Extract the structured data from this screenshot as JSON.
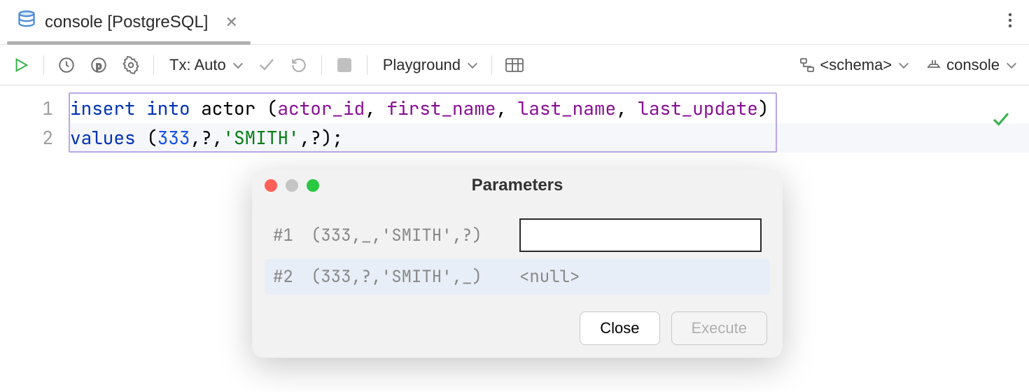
{
  "tab": {
    "label": "console [PostgreSQL]"
  },
  "toolbar": {
    "tx_label": "Tx: Auto",
    "playground_label": "Playground",
    "schema_label": "<schema>",
    "console_label": "console"
  },
  "editor": {
    "lines": [
      {
        "num": "1",
        "segments": [
          {
            "text": "insert into",
            "cls": "kw"
          },
          {
            "text": " actor (",
            "cls": ""
          },
          {
            "text": "actor_id",
            "cls": "ident"
          },
          {
            "text": ", ",
            "cls": ""
          },
          {
            "text": "first_name",
            "cls": "ident"
          },
          {
            "text": ", ",
            "cls": ""
          },
          {
            "text": "last_name",
            "cls": "ident"
          },
          {
            "text": ", ",
            "cls": ""
          },
          {
            "text": "last_update",
            "cls": "ident"
          },
          {
            "text": ")",
            "cls": ""
          }
        ]
      },
      {
        "num": "2",
        "segments": [
          {
            "text": "values ",
            "cls": "kw"
          },
          {
            "text": "(",
            "cls": ""
          },
          {
            "text": "333",
            "cls": "num"
          },
          {
            "text": ",?,",
            "cls": ""
          },
          {
            "text": "'SMITH'",
            "cls": "str"
          },
          {
            "text": ",?)",
            "cls": ""
          },
          {
            "text": ";",
            "cls": ""
          }
        ]
      }
    ]
  },
  "dialog": {
    "title": "Parameters",
    "rows": [
      {
        "idx": "#1",
        "ctx": "(333,_,'SMITH',?)",
        "value": "",
        "input": true
      },
      {
        "idx": "#2",
        "ctx": "(333,?,'SMITH',_)",
        "value": "<null>",
        "input": false
      }
    ],
    "close_label": "Close",
    "execute_label": "Execute"
  }
}
